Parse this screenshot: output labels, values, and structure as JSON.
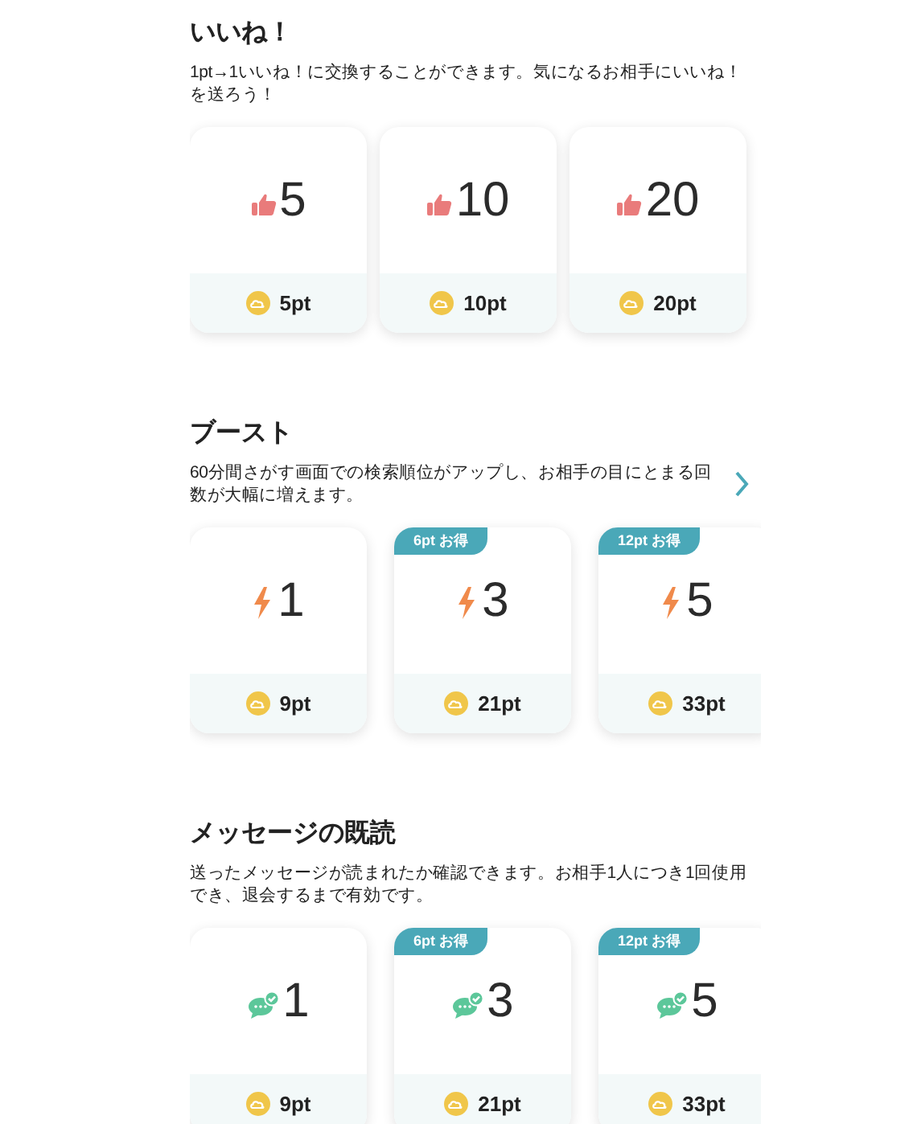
{
  "sections": [
    {
      "title": "いいね！",
      "description": "1pt→1いいね！に交換することができます。気になるお相手にいいね！を送ろう！",
      "has_link": false,
      "items": [
        {
          "kind": "like",
          "count": "5",
          "price": "5pt"
        },
        {
          "kind": "like",
          "count": "10",
          "price": "10pt"
        },
        {
          "kind": "like",
          "count": "20",
          "price": "20pt"
        }
      ]
    },
    {
      "title": "ブースト",
      "description": "60分間さがす画面での検索順位がアップし、お相手の目にとまる回数が大幅に増えます。",
      "has_link": true,
      "items": [
        {
          "kind": "boost",
          "count": "1",
          "price": "9pt"
        },
        {
          "kind": "boost",
          "count": "3",
          "price": "21pt",
          "badge": "6pt お得"
        },
        {
          "kind": "boost",
          "count": "5",
          "price": "33pt",
          "badge": "12pt お得"
        }
      ]
    },
    {
      "title": "メッセージの既読",
      "description": "送ったメッセージが読まれたか確認できます。お相手1人につき1回使用でき、退会するまで有効です。",
      "has_link": false,
      "items": [
        {
          "kind": "read",
          "count": "1",
          "price": "9pt"
        },
        {
          "kind": "read",
          "count": "3",
          "price": "21pt",
          "badge": "6pt お得"
        },
        {
          "kind": "read",
          "count": "5",
          "price": "33pt",
          "badge": "12pt お得"
        }
      ]
    }
  ]
}
